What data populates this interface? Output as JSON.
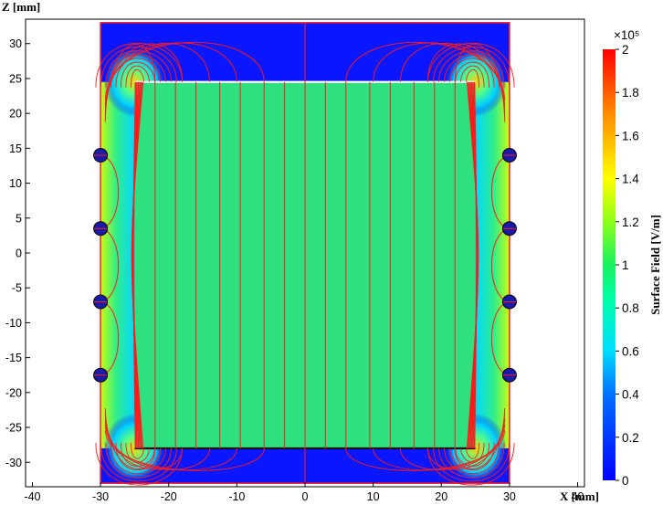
{
  "chart_data": {
    "type": "heatmap",
    "xlabel": "X [mm]",
    "ylabel": "Z [mm]",
    "xlim": [
      -41,
      41
    ],
    "ylim": [
      -33.5,
      33.5
    ],
    "x_ticks": [
      -40,
      -30,
      -20,
      -10,
      0,
      10,
      20,
      30,
      40
    ],
    "y_ticks": [
      30,
      25,
      20,
      15,
      10,
      5,
      0,
      -5,
      -10,
      -15,
      -20,
      -25,
      -30
    ],
    "domain": {
      "x": [
        -30,
        30
      ],
      "z": [
        -33,
        33
      ]
    },
    "electrode": {
      "x": [
        -25,
        25
      ],
      "z": [
        -28,
        24.5
      ]
    },
    "coils": [
      {
        "x": -30,
        "z": 14
      },
      {
        "x": -30,
        "z": 3.5
      },
      {
        "x": -30,
        "z": -7
      },
      {
        "x": -30,
        "z": -17.5
      },
      {
        "x": 30,
        "z": 14
      },
      {
        "x": 30,
        "z": 3.5
      },
      {
        "x": 30,
        "z": -7
      },
      {
        "x": 30,
        "z": -17.5
      }
    ],
    "field_line_x": [
      -22,
      -19,
      -16,
      -12.5,
      -9.5,
      -6,
      -3,
      0,
      3,
      6,
      9.5,
      12.5,
      16,
      19,
      22
    ],
    "colorbar": {
      "label": "Surface Field [V/m]",
      "multiplier": "×10⁵",
      "min": 0,
      "max": 2,
      "ticks": [
        "2",
        "1.8",
        "1.6",
        "1.4",
        "1.2",
        "1",
        "0.8",
        "0.6",
        "0.4",
        "0.2",
        "0"
      ],
      "colormap": "rainbow"
    },
    "colors": {
      "interior": "#2ee07e",
      "exterior": "#0a16ff",
      "field_line": "#ff1a1a",
      "coil": "#1a1aa8"
    }
  }
}
